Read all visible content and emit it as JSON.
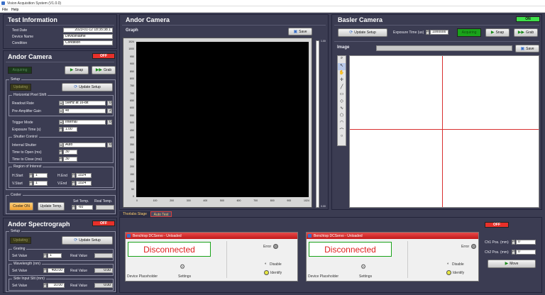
{
  "window": {
    "title": "Vision Acquisition System (V1.0.0)"
  },
  "menu": {
    "file": "File",
    "help": "Help"
  },
  "test_info": {
    "title": "Test Information",
    "date_label": "Test Date",
    "date_value": "2023-01-12 18:35:38.1",
    "device_label": "Device Name",
    "device_value": "DeviceName",
    "condition_label": "Condition",
    "condition_value": "Condition"
  },
  "andor_camera_ctrl": {
    "title": "Andor Camera",
    "power": "OFF",
    "acquiring": "Acquiring",
    "snap": "Snap",
    "grab": "Grab",
    "setup_group": "Setup",
    "updating": "Updating",
    "update_setup": "Update Setup",
    "hps_group": "Horizontal Pixel Shift",
    "readout_label": "Readout Rate",
    "readout_value": "5MHz at 16-bit",
    "readout_idx": "0",
    "preamp_label": "Pre-Amplifier Gain",
    "preamp_value": "4x",
    "preamp_idx": "2",
    "trigger_label": "Trigger Mode",
    "trigger_value": "Internal",
    "trigger_idx": "0",
    "exposure_label": "Exposure Time (s)",
    "exposure_value": "1.00",
    "shutter_group": "Shutter Control",
    "int_shutter_label": "Internal Shutter",
    "int_shutter_value": "Auto",
    "int_shutter_idx": "0",
    "open_label": "Time to Open (ms)",
    "open_value": "30",
    "close_label": "Time to Close (ms)",
    "close_value": "30",
    "roi_group": "Region of Interest",
    "hstart_label": "H.Start",
    "hstart_value": "1",
    "hend_label": "H.End",
    "hend_value": "1024",
    "vstart_label": "V.Start",
    "vstart_value": "1",
    "vend_label": "V.End",
    "vend_value": "1024",
    "cooler_group": "Cooler",
    "cooler_on": "Cooler ON",
    "update_temp": "Update Temp.",
    "set_temp_label": "Set Temp.",
    "set_temp_value": "-60",
    "real_temp_label": "Real Temp."
  },
  "spectrograph": {
    "title": "Andor Spectrograph",
    "power": "OFF",
    "setup_group": "Setup",
    "updating": "Updating",
    "update_setup": "Update Setup",
    "grating_group": "Grating",
    "grating_set_label": "Set Value",
    "grating_set_value": "1",
    "grating_real_label": "Real Value",
    "wavelength_group": "Wavelength (nm)",
    "wl_set_label": "Set Value",
    "wl_set_value": "400.00",
    "wl_real_label": "Real Value",
    "wl_real_value": "0.00",
    "slit_group": "Side Input Slit (mm)",
    "slit_set_label": "Set Value",
    "slit_set_value": "10.00",
    "slit_real_label": "Real Value",
    "slit_real_value": "0.00"
  },
  "andor_view": {
    "title": "Andor Camera",
    "graph_label": "Graph",
    "save": "Save",
    "y_ticks": [
      "1024",
      "1000",
      "950",
      "900",
      "850",
      "800",
      "750",
      "700",
      "650",
      "600",
      "550",
      "500",
      "450",
      "400",
      "350",
      "300",
      "250",
      "200",
      "150",
      "100",
      "50",
      "0"
    ],
    "x_ticks": [
      "0",
      "100",
      "200",
      "300",
      "400",
      "500",
      "600",
      "700",
      "800",
      "900",
      "1024"
    ],
    "scale_top": "1.00",
    "scale_bottom": "0.00"
  },
  "basler": {
    "title": "Basler Camera",
    "power": "ON",
    "update_setup": "Update Setup",
    "exposure_label": "Exposure Time (us)",
    "exposure_value": "1000000",
    "acquiring": "Acquiring",
    "snap": "Snap",
    "grab": "Grab",
    "image_label": "Image",
    "save": "Save"
  },
  "tabs": {
    "thorlabs": "Thorlabs Stage",
    "auto_test": "Auto Test"
  },
  "stage1": {
    "header": "Benchtop DCServo - Unloaded",
    "status": "Disconnected",
    "error": "Error",
    "disable": "Disable",
    "identify": "Identify",
    "placeholder": "Device Placeholder",
    "settings": "Settings"
  },
  "stage2": {
    "header": "Benchtop DCServo - Unloaded",
    "status": "Disconnected",
    "error": "Error",
    "disable": "Disable",
    "identify": "Identify",
    "placeholder": "Device Placeholder",
    "settings": "Settings"
  },
  "stage_ctrl": {
    "power": "OFF",
    "ch1_label": "Ch1 Pos. (mm)",
    "ch1_value": "0",
    "ch2_label": "Ch2 Pos. (mm)",
    "ch2_value": "0",
    "move": "Move"
  },
  "colors": {
    "panel": "#3b3c52",
    "off_led": "#e8302a",
    "on_led": "#3ee04a",
    "green_status": "#1aa31a",
    "status_red": "#e02020"
  },
  "icons": {
    "snap": "camera-icon",
    "grab": "grab-icon",
    "update": "refresh-icon",
    "save": "save-icon",
    "move": "arrow-right-icon"
  }
}
